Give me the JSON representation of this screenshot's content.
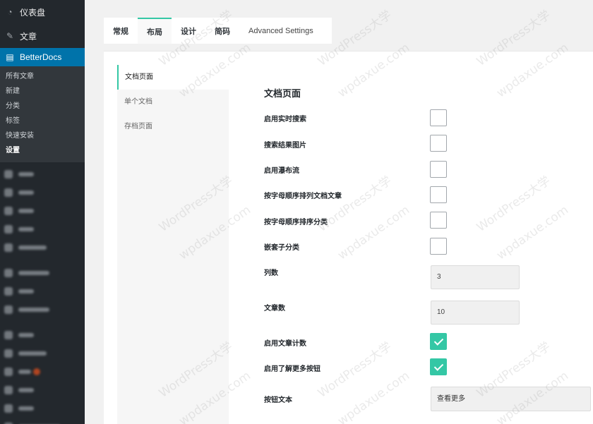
{
  "sidebar": {
    "dashboard": "仪表盘",
    "posts": "文章",
    "plugin": "BetterDocs",
    "submenu": [
      "所有文章",
      "新建",
      "分类",
      "标签",
      "快速安装",
      "设置"
    ],
    "active_submenu": "设置"
  },
  "tabs": [
    "常规",
    "布局",
    "设计",
    "简码",
    "Advanced Settings"
  ],
  "active_tab": "布局",
  "subnav": [
    "文档页面",
    "单个文档",
    "存档页面"
  ],
  "active_subnav": "文档页面",
  "section": {
    "title": "文档页面",
    "fields": [
      {
        "label": "启用实时搜索",
        "type": "checkbox",
        "checked": false
      },
      {
        "label": "搜索结果图片",
        "type": "checkbox",
        "checked": false
      },
      {
        "label": "启用瀑布流",
        "type": "checkbox",
        "checked": false
      },
      {
        "label": "按字母顺序排列文档文章",
        "type": "checkbox",
        "checked": false
      },
      {
        "label": "按字母顺序排序分类",
        "type": "checkbox",
        "checked": false
      },
      {
        "label": "嵌套子分类",
        "type": "checkbox",
        "checked": false
      },
      {
        "label": "列数",
        "type": "number",
        "value": "3"
      },
      {
        "label": "文章数",
        "type": "number",
        "value": "10"
      },
      {
        "label": "启用文章计数",
        "type": "checkbox",
        "checked": true
      },
      {
        "label": "启用了解更多按钮",
        "type": "checkbox",
        "checked": true
      },
      {
        "label": "按钮文本",
        "type": "text",
        "value": "查看更多"
      }
    ]
  },
  "watermark": {
    "site": "WordPress大学",
    "domain": "wpdaxue.com"
  },
  "colors": {
    "accent": "#34c7a5",
    "sidebar_bg": "#23282d",
    "sidebar_current": "#0073aa"
  }
}
